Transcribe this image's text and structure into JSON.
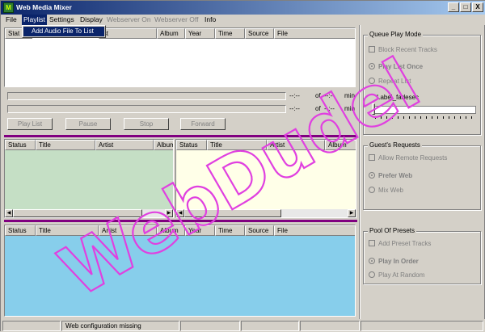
{
  "window": {
    "title": "Web Media Mixer",
    "min": "_",
    "max": "□",
    "close": "X"
  },
  "menu": {
    "items": [
      "File",
      "Playlist",
      "Settings",
      "Display",
      "Webserver On",
      "Webserver Off",
      "Info"
    ]
  },
  "dropdown": {
    "item": "Add Audio File To List"
  },
  "columns": [
    "Status",
    "Title",
    "Artist",
    "Album",
    "Year",
    "Time",
    "Source",
    "File"
  ],
  "playlist_header_partial": [
    "Stat",
    "ist",
    "Album",
    "Year",
    "Time",
    "Source",
    "File"
  ],
  "progress": {
    "time1": "--:--",
    "of1": "of",
    "total1": "--:--",
    "unit1": "min",
    "time2": "--:--",
    "of2": "of",
    "total2": "--:--",
    "unit2": "min"
  },
  "controls": {
    "play_list": "Play List",
    "pause": "Pause",
    "stop": "Stop",
    "forward": "Forward"
  },
  "guest_left_cols": [
    "Status",
    "Title",
    "Artist",
    "Album"
  ],
  "guest_right_cols": [
    "Status",
    "Title",
    "Artist",
    "Album"
  ],
  "presets_cols": [
    "Status",
    "Title",
    "Artist",
    "Album",
    "Year",
    "Time",
    "Source",
    "File"
  ],
  "queue_play_mode": {
    "title": "Queue Play Mode",
    "block_recent": "Block Recent Tracks",
    "play_once": "Play List Once",
    "repeat": "Repeat List",
    "fade_label": "Label_fadesec"
  },
  "guests_requests": {
    "title": "Guest's Requests",
    "allow_remote": "Allow Remote Requests",
    "prefer_web": "Prefer Web",
    "mix_web": "Mix Web"
  },
  "pool_of_presets": {
    "title": "Pool Of Presets",
    "add_preset": "Add Preset Tracks",
    "play_in_order": "Play In Order",
    "play_at_random": "Play At Random"
  },
  "status": {
    "message": "Web configuration missing"
  },
  "watermark": "WebDudel",
  "colors": {
    "guest_left_bg": "#c5dfc5",
    "guest_right_bg": "#ffffe8",
    "presets_bg": "#87ceeb",
    "separator": "#800080",
    "watermark": "#e040e0"
  }
}
